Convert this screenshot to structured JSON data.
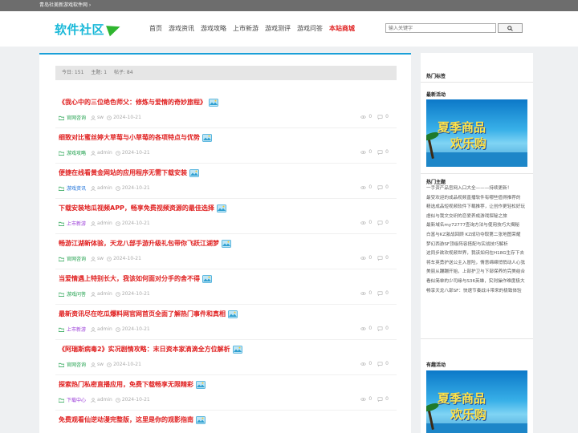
{
  "topbar": {
    "text": "青岛社美新游戏软件网 ›"
  },
  "header": {
    "logo_text": "软件社区",
    "nav": [
      "首页",
      "游戏资讯",
      "游戏攻略",
      "上市新游",
      "游戏测评",
      "游戏问答"
    ],
    "store_label": "本站商城",
    "search_placeholder": "输入关键字"
  },
  "stats": {
    "today": "今日: 151",
    "topics": "主题: 1",
    "posts": "帖子: 84"
  },
  "posts": [
    {
      "title": "《我心中的三位绝色师父：修炼与爱情的奇妙旅程》",
      "category": "官网咨询",
      "cat_color": "green",
      "author": "sw",
      "date": "2024-10-21",
      "views": "0",
      "comments": "0"
    },
    {
      "title": "细致对比蜜丝婷大草莓与小草莓的各项特点与优势",
      "category": "游戏攻略",
      "cat_color": "green",
      "author": "admin",
      "date": "2024-10-21",
      "views": "0",
      "comments": "0"
    },
    {
      "title": "便捷在线看黄金网站的应用程序无需下载安装",
      "category": "游戏资讯",
      "cat_color": "blue",
      "author": "admin",
      "date": "2024-10-21",
      "views": "0",
      "comments": "0"
    },
    {
      "title": "下载安装地瓜视频APP，畅享免费视频资源的最佳选择",
      "category": "上市新游",
      "cat_color": "purple",
      "author": "admin",
      "date": "2024-10-21",
      "views": "0",
      "comments": "0"
    },
    {
      "title": "畅游江湖新体验，天龙八部手游升级礼包带你飞跃江湖梦",
      "category": "官网咨询",
      "cat_color": "green",
      "author": "sw",
      "date": "2024-10-21",
      "views": "0",
      "comments": "0"
    },
    {
      "title": "当爱情遇上特别长大，我该如何面对分手的舍不得",
      "category": "游戏问答",
      "cat_color": "green",
      "author": "admin",
      "date": "2024-10-21",
      "views": "0",
      "comments": "0"
    },
    {
      "title": "最新资讯尽在吃瓜爆料网官网首页全面了解热门事件和真相",
      "category": "上市新游",
      "cat_color": "purple",
      "author": "admin",
      "date": "2024-10-21",
      "views": "0",
      "comments": "0"
    },
    {
      "title": "《阿瑞斯病毒2》实况剧情攻略：末日资本家滴滴全方位解析",
      "category": "官网咨询",
      "cat_color": "green",
      "author": "sw",
      "date": "2024-10-21",
      "views": "0",
      "comments": "0"
    },
    {
      "title": "探索热门私密直播应用，免费下载畅享无限精彩",
      "category": "下载中心",
      "cat_color": "purple",
      "author": "admin",
      "date": "2024-10-21",
      "views": "0",
      "comments": "0"
    },
    {
      "title": "免费观看仙逆动漫完整版，这里是你的观影指南",
      "category": "",
      "cat_color": "green",
      "author": "",
      "date": "",
      "views": "",
      "comments": ""
    }
  ],
  "sidebar": {
    "tags_title": "热门标签",
    "latest_title": "最新活动",
    "banner_line1": "夏季商品",
    "banner_line2": "欢乐购",
    "hot_title": "热门主题",
    "hot_items": [
      "一手资产品官网入口大全———持续更新！",
      "最受欢迎的成品视频直播软件有哪些值得推荐的",
      "精选成品短视频软件下载推荐，让创作更轻松好玩",
      "虐似与我文交织的恋爱养成游戏探秘之旅",
      "最新域名my72777查询方法与使用技巧大揭秘",
      "白富与KZ激战回顾 KZ成功夺取第二张地图荣耀",
      "梦幻西游SF顶级阵容搭配与实战技巧解析",
      "这同步欲欢视频世界，我该如何在H18G生存下去",
      "将车英勇护送公主入冒险，情意绵绵悄悄动人心弦",
      "美丽从蹦蹦开始，上部护卫与下部保养的完美结合",
      "看似简单的少司缘与S36英雄，实则操作难度极大",
      "畅享天龙八部SF：快速节奏战斗带来的极致体验"
    ],
    "fun_title": "有趣活动",
    "banner2_line1": "夏季商品",
    "banner2_line2": "欢乐购"
  }
}
